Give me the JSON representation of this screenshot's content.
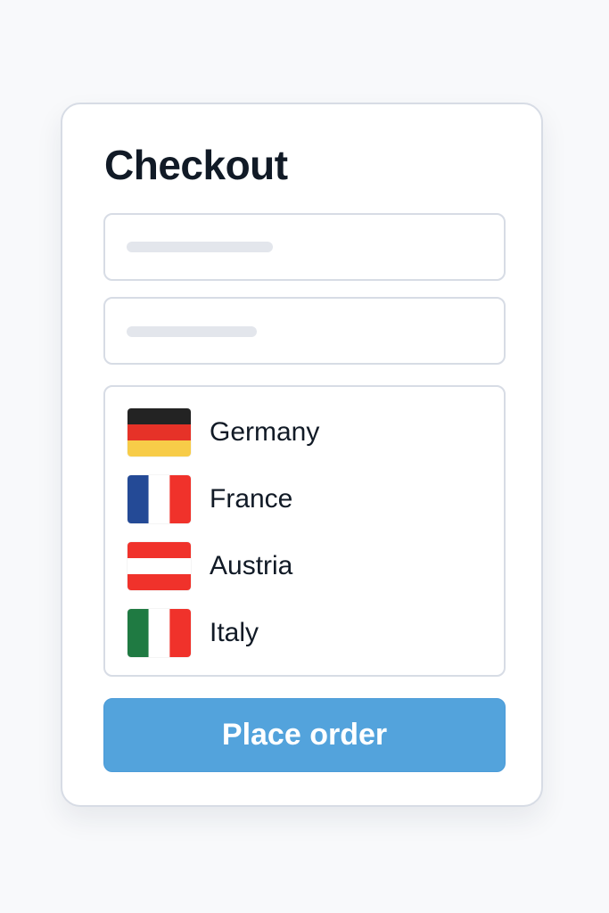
{
  "checkout": {
    "title": "Checkout",
    "countries": [
      {
        "label": "Germany",
        "flag_icon": "germany-flag-icon",
        "colors": [
          "#232323",
          "#e63228",
          "#f7cc48"
        ]
      },
      {
        "label": "France",
        "flag_icon": "france-flag-icon",
        "colors": [
          "#244a96",
          "#ffffff",
          "#f0322b"
        ]
      },
      {
        "label": "Austria",
        "flag_icon": "austria-flag-icon",
        "colors": [
          "#f0322b",
          "#ffffff",
          "#f0322b"
        ]
      },
      {
        "label": "Italy",
        "flag_icon": "italy-flag-icon",
        "colors": [
          "#1f7a42",
          "#ffffff",
          "#f0322b"
        ]
      }
    ],
    "submit_label": "Place order",
    "accent_color": "#53a3dc"
  }
}
